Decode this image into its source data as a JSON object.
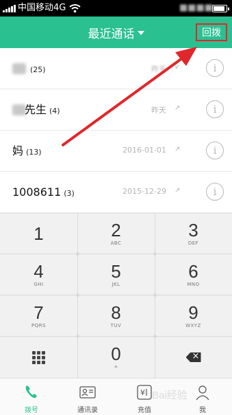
{
  "status_bar": {
    "carrier": "中国移动4G"
  },
  "header": {
    "title": "最近通话",
    "callback_button": "回拨"
  },
  "call_log": [
    {
      "name": "",
      "count": "(25)",
      "date": "昨天",
      "direction": "↙",
      "blurred_name": true
    },
    {
      "name": "先生",
      "count": "(4)",
      "date": "昨天",
      "direction": "↗",
      "blurred_name": true
    },
    {
      "name": "妈",
      "count": "(13)",
      "date": "2016-01-01",
      "direction": "↗",
      "blurred_name": false
    },
    {
      "name": "1008611",
      "count": "(3)",
      "date": "2015-12-29",
      "direction": "↗",
      "blurred_name": false
    }
  ],
  "info_glyph": "i",
  "dialpad": [
    {
      "digit": "1",
      "letters": ""
    },
    {
      "digit": "2",
      "letters": "ABC"
    },
    {
      "digit": "3",
      "letters": "DEF"
    },
    {
      "digit": "4",
      "letters": "GHI"
    },
    {
      "digit": "5",
      "letters": "JKL"
    },
    {
      "digit": "6",
      "letters": "MNO"
    },
    {
      "digit": "7",
      "letters": "PQRS"
    },
    {
      "digit": "8",
      "letters": "TUV"
    },
    {
      "digit": "9",
      "letters": "WXYZ"
    },
    {
      "digit": "0",
      "letters": "+"
    }
  ],
  "dialpad_icons": {
    "left": "keypad-grid-icon",
    "right": "backspace-icon"
  },
  "bottom_nav": [
    {
      "label": "拨号",
      "icon": "phone-icon",
      "active": true
    },
    {
      "label": "通讯录",
      "icon": "contacts-icon",
      "active": false
    },
    {
      "label": "充值",
      "icon": "recharge-icon",
      "active": false
    },
    {
      "label": "我",
      "icon": "profile-icon",
      "active": false
    }
  ],
  "watermark": "Bai经验",
  "colors": {
    "brand": "#2bc090",
    "highlight": "#e0272b"
  },
  "battery_level": 0.9
}
